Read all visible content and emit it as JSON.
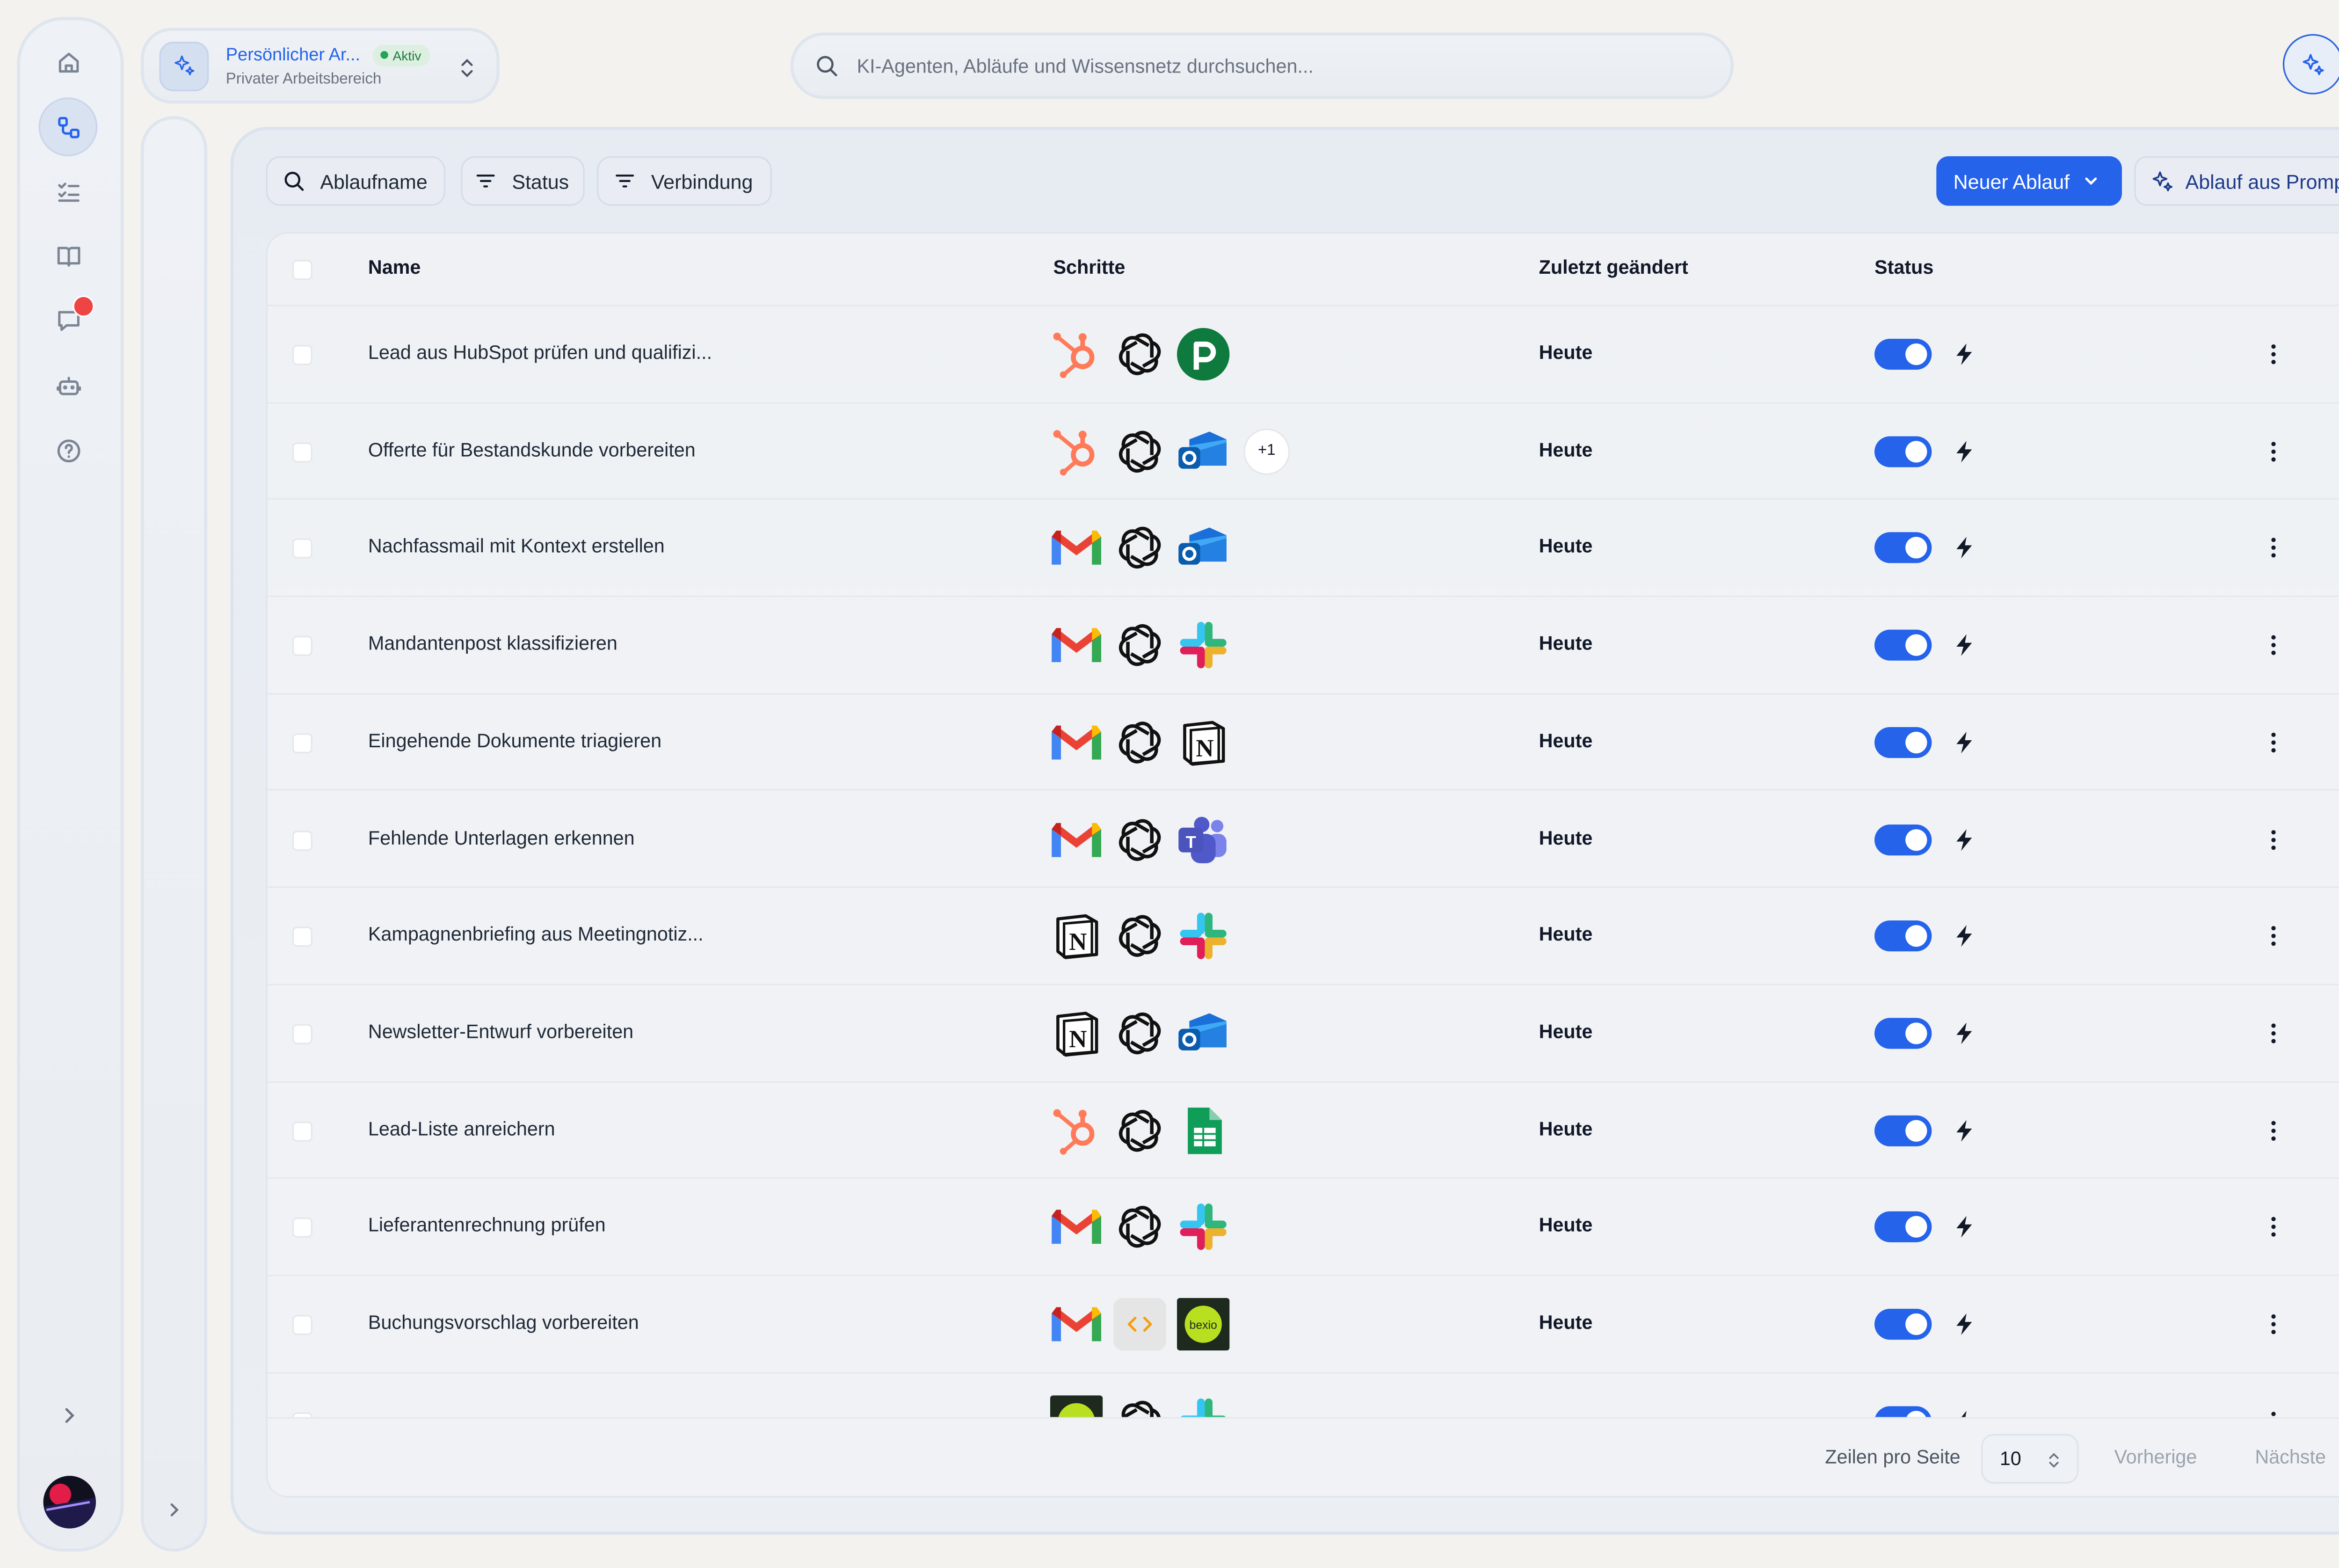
{
  "workspace": {
    "title": "Persönlicher Ar...",
    "badge": "Aktiv",
    "subtitle": "Privater Arbeitsbereich"
  },
  "search": {
    "placeholder": "KI-Agenten, Abläufe und Wissensnetz durchsuchen..."
  },
  "sidebar": {
    "items": [
      {
        "icon": "home-icon"
      },
      {
        "icon": "workflow-icon",
        "active": true
      },
      {
        "icon": "tasks-icon"
      },
      {
        "icon": "book-icon"
      },
      {
        "icon": "chat-icon",
        "notification": true
      },
      {
        "icon": "robot-icon"
      },
      {
        "icon": "help-icon"
      }
    ]
  },
  "filters": {
    "name": "Ablaufname",
    "status": "Status",
    "connection": "Verbindung"
  },
  "actions": {
    "new_flow": "Neuer Ablauf",
    "from_prompt": "Ablauf aus Prompt"
  },
  "table": {
    "headers": {
      "name": "Name",
      "steps": "Schritte",
      "modified": "Zuletzt geändert",
      "status": "Status"
    },
    "rows": [
      {
        "name": "Lead aus HubSpot prüfen und qualifizi...",
        "steps": [
          "hubspot",
          "openai",
          "pipedrive"
        ],
        "extra": "",
        "modified": "Heute",
        "active": true
      },
      {
        "name": "Offerte für Bestandskunde vorbereiten",
        "steps": [
          "hubspot",
          "openai",
          "outlook"
        ],
        "extra": "+1",
        "modified": "Heute",
        "active": true
      },
      {
        "name": "Nachfassmail mit Kontext erstellen",
        "steps": [
          "gmail",
          "openai",
          "outlook"
        ],
        "extra": "",
        "modified": "Heute",
        "active": true
      },
      {
        "name": "Mandantenpost klassifizieren",
        "steps": [
          "gmail",
          "openai",
          "slack"
        ],
        "extra": "",
        "modified": "Heute",
        "active": true
      },
      {
        "name": "Eingehende Dokumente triagieren",
        "steps": [
          "gmail",
          "openai",
          "notion"
        ],
        "extra": "",
        "modified": "Heute",
        "active": true
      },
      {
        "name": "Fehlende Unterlagen erkennen",
        "steps": [
          "gmail",
          "openai",
          "teams"
        ],
        "extra": "",
        "modified": "Heute",
        "active": true
      },
      {
        "name": "Kampagnenbriefing aus Meetingnotiz...",
        "steps": [
          "notion",
          "openai",
          "slack"
        ],
        "extra": "",
        "modified": "Heute",
        "active": true
      },
      {
        "name": "Newsletter-Entwurf vorbereiten",
        "steps": [
          "notion",
          "openai",
          "outlook"
        ],
        "extra": "",
        "modified": "Heute",
        "active": true
      },
      {
        "name": "Lead-Liste anreichern",
        "steps": [
          "hubspot",
          "openai",
          "sheets"
        ],
        "extra": "",
        "modified": "Heute",
        "active": true
      },
      {
        "name": "Lieferantenrechnung prüfen",
        "steps": [
          "gmail",
          "openai",
          "slack"
        ],
        "extra": "",
        "modified": "Heute",
        "active": true
      },
      {
        "name": "Buchungsvorschlag vorbereiten",
        "steps": [
          "gmail",
          "code",
          "bexio"
        ],
        "extra": "",
        "modified": "Heute",
        "active": true
      },
      {
        "name": "",
        "steps": [
          "bexio",
          "openai",
          "slack"
        ],
        "extra": "",
        "modified": "",
        "active": true
      }
    ]
  },
  "pagination": {
    "rows_per_page_label": "Zeilen pro Seite",
    "rows_per_page": "10",
    "prev": "Vorherige",
    "next": "Nächste"
  },
  "colors": {
    "accent": "#2563eb",
    "notification": "#ef4444",
    "active_badge": "#22a35a"
  }
}
